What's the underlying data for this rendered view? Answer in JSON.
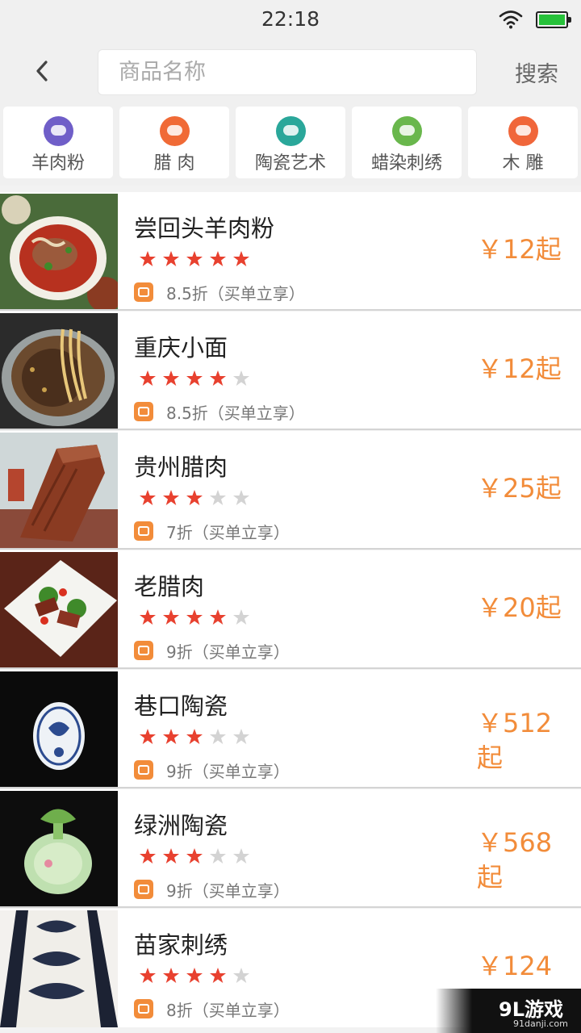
{
  "status_bar": {
    "time": "22:18",
    "wifi_icon": "wifi-icon",
    "battery_icon": "battery-icon"
  },
  "search": {
    "back_icon": "chevron-left-icon",
    "placeholder": "商品名称",
    "value": "",
    "button_label": "搜索"
  },
  "categories": [
    {
      "label": "羊肉粉",
      "icon": "noodle-bowl-icon",
      "color": "#6f5ec8"
    },
    {
      "label": "腊 肉",
      "icon": "cured-meat-icon",
      "color": "#f06a36"
    },
    {
      "label": "陶瓷艺术",
      "icon": "ceramic-bowl-icon",
      "color": "#2aa79a"
    },
    {
      "label": "蜡染刺绣",
      "icon": "embroidery-icon",
      "color": "#69b74c"
    },
    {
      "label": "木 雕",
      "icon": "wood-carving-icon",
      "color": "#f0663a"
    }
  ],
  "products": [
    {
      "name": "尝回头羊肉粉",
      "rating": 5,
      "discount": "8.5折（买单立享）",
      "price": "￥12起",
      "image": "mutton-noodle-photo"
    },
    {
      "name": "重庆小面",
      "rating": 4,
      "discount": "8.5折（买单立享）",
      "price": "￥12起",
      "image": "chongqing-noodle-photo"
    },
    {
      "name": "贵州腊肉",
      "rating": 3,
      "discount": "7折（买单立享）",
      "price": "￥25起",
      "image": "cured-pork-photo"
    },
    {
      "name": "老腊肉",
      "rating": 4,
      "discount": "9折（买单立享）",
      "price": "￥20起",
      "image": "cured-pork-dish-photo"
    },
    {
      "name": "巷口陶瓷",
      "rating": 3,
      "discount": "9折（买单立享）",
      "price": "￥512起",
      "image": "blue-white-plate-photo"
    },
    {
      "name": "绿洲陶瓷",
      "rating": 3,
      "discount": "9折（买单立享）",
      "price": "￥568起",
      "image": "green-vase-photo"
    },
    {
      "name": "苗家刺绣",
      "rating": 4,
      "discount": "8折（买单立享）",
      "price": "￥124",
      "image": "embroidery-cloth-photo"
    }
  ],
  "colors": {
    "accent": "#f28c3a",
    "star_on": "#e8412f",
    "star_off": "#d3d3d3"
  },
  "watermark": {
    "text": "9L游戏",
    "sub": "91danji.com"
  }
}
